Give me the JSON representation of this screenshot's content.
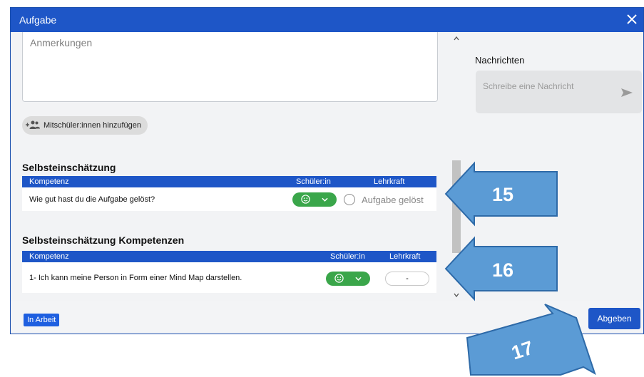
{
  "dialog": {
    "title": "Aufgabe",
    "close_icon": "close-icon"
  },
  "notes": {
    "placeholder": "Anmerkungen"
  },
  "add_classmates": {
    "label": "Mitschüler:innen hinzufügen",
    "icon": "add-people-icon"
  },
  "self_assessment": {
    "heading": "Selbsteinschätzung",
    "columns": [
      "Kompetenz",
      "Schüler:in",
      "Lehrkraft"
    ],
    "row": {
      "question": "Wie gut hast du die Aufgabe gelöst?",
      "student_value_icon": "smiley-icon",
      "teacher_label": "Aufgabe gelöst"
    }
  },
  "competency_assessment": {
    "heading": "Selbsteinschätzung Kompetenzen",
    "columns": [
      "Kompetenz",
      "Schüler:in",
      "Lehrkraft"
    ],
    "row": {
      "question": "1- Ich kann meine Person in Form einer Mind Map darstellen.",
      "student_value_icon": "smiley-icon",
      "teacher_value": "-"
    }
  },
  "messages": {
    "label": "Nachrichten",
    "placeholder": "Schreibe eine Nachricht",
    "send_icon": "send-icon"
  },
  "footer": {
    "status": "In Arbeit",
    "submit": "Abgeben"
  },
  "callouts": [
    "15",
    "16",
    "17"
  ],
  "colors": {
    "primary": "#1e56c7",
    "success": "#3aa64a",
    "callout": "#5b9bd5"
  }
}
